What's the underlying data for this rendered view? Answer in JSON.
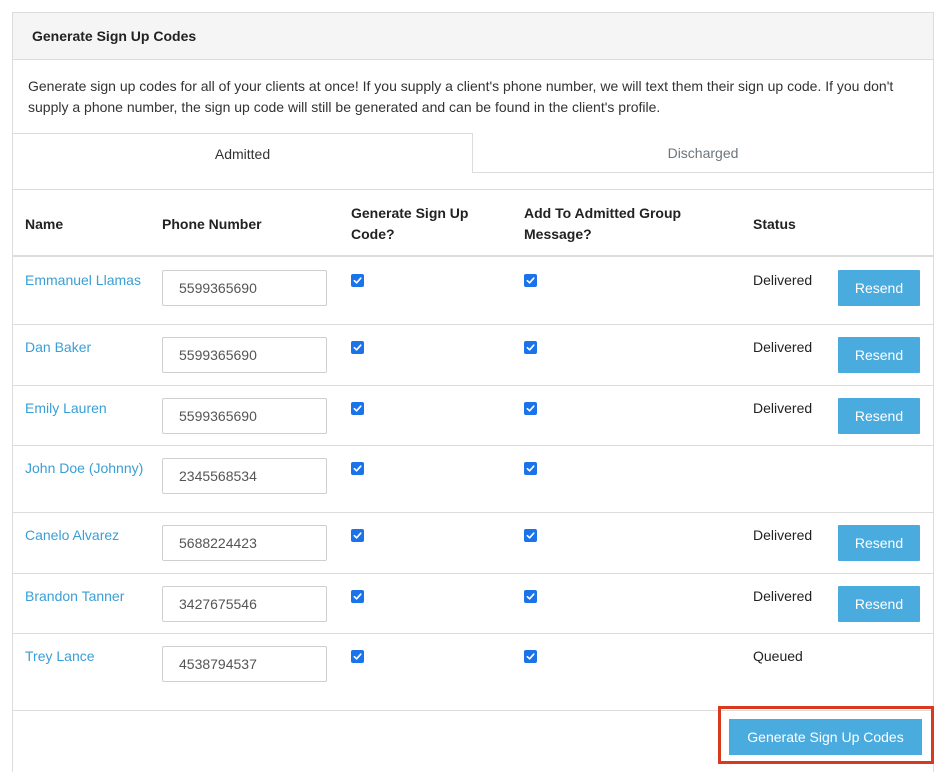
{
  "panel": {
    "title": "Generate Sign Up Codes",
    "intro": "Generate sign up codes for all of your clients at once! If you supply a client's phone number, we will text them their sign up code. If you don't supply a phone number, the sign up code will still be generated and can be found in the client's profile."
  },
  "tabs": {
    "admitted": "Admitted",
    "discharged": "Discharged"
  },
  "table": {
    "headers": {
      "name": "Name",
      "phone": "Phone Number",
      "generate_line1": "Generate Sign Up",
      "generate_line2": "Code?",
      "add_line1": "Add To Admitted Group",
      "add_line2": "Message?",
      "status": "Status"
    },
    "rows": [
      {
        "name": "Emmanuel Llamas",
        "phone": "5599365690",
        "generate": true,
        "add": true,
        "status": "Delivered",
        "action": "Resend"
      },
      {
        "name": "Dan Baker",
        "phone": "5599365690",
        "generate": true,
        "add": true,
        "status": "Delivered",
        "action": "Resend"
      },
      {
        "name": "Emily Lauren",
        "phone": "5599365690",
        "generate": true,
        "add": true,
        "status": "Delivered",
        "action": "Resend"
      },
      {
        "name": "John Doe (Johnny)",
        "phone": "2345568534",
        "generate": true,
        "add": true,
        "status": "",
        "action": ""
      },
      {
        "name": "Canelo Alvarez",
        "phone": "5688224423",
        "generate": true,
        "add": true,
        "status": "Delivered",
        "action": "Resend"
      },
      {
        "name": "Brandon Tanner",
        "phone": "3427675546",
        "generate": true,
        "add": true,
        "status": "Delivered",
        "action": "Resend"
      },
      {
        "name": "Trey Lance",
        "phone": "4538794537",
        "generate": true,
        "add": true,
        "status": "Queued",
        "action": ""
      }
    ]
  },
  "footer": {
    "generate_button": "Generate Sign Up Codes"
  },
  "colors": {
    "link": "#3a9fd6",
    "button": "#4aabde",
    "checkbox": "#1a73e8",
    "highlight": "#d93a1e"
  }
}
